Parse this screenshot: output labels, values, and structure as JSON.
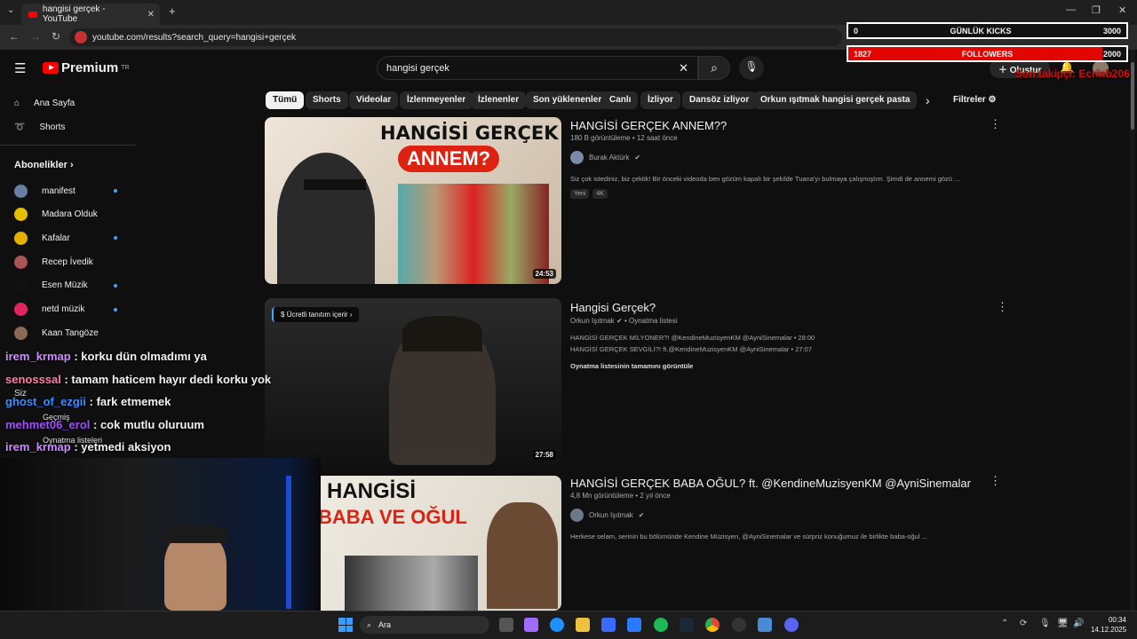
{
  "browser": {
    "tab_title": "hangisi gerçek - YouTube",
    "url": "youtube.com/results?search_query=hangisi+gerçek"
  },
  "header": {
    "logo_text": "Premium",
    "logo_region": "TR",
    "search_value": "hangisi gerçek",
    "create_label": "Oluştur"
  },
  "sidebar": {
    "items": [
      {
        "label": "Ana Sayfa"
      },
      {
        "label": "Shorts"
      }
    ],
    "subscriptions_title": "Abonelikler",
    "channels": [
      {
        "name": "manifest",
        "color": "#6a7fa8",
        "dot": true
      },
      {
        "name": "Madara Olduk",
        "color": "#e5c000",
        "dot": false
      },
      {
        "name": "Kafalar",
        "color": "#e5b000",
        "dot": true
      },
      {
        "name": "Recep İvedik",
        "color": "#a55",
        "dot": false
      },
      {
        "name": "Esen Müzik",
        "color": "#111",
        "dot": true
      },
      {
        "name": "netd müzik",
        "color": "#e0245e",
        "dot": true
      },
      {
        "name": "Kaan Tangöze",
        "color": "#8a6a55",
        "dot": false
      }
    ],
    "you_label": "Siz",
    "history_label": "Geçmiş",
    "playlists_label": "Oynatma listeleri"
  },
  "chips": [
    "Tümü",
    "Shorts",
    "Videolar",
    "İzlenmeyenler",
    "İzlenenler",
    "Son yüklenenler",
    "Canlı",
    "İzliyor",
    "Dansöz izliyor",
    "Orkun ışıtmak hangisi gerçek pasta"
  ],
  "filters_label": "Filtreler",
  "results": [
    {
      "title": "HANGİSİ GERÇEK ANNEM??",
      "meta": "180 B görüntüleme • 12 saat önce",
      "channel": "Burak Aktürk",
      "desc": "Siz çok istediniz, biz çektik! Bir önceki videoda ben gözüm kapalı bir şekilde Tuana'yı bulmaya çalışmıştım. Şimdi de annemi gözü ...",
      "badges": [
        "Yeni",
        "4K"
      ],
      "duration": "24:53",
      "thumb_text1": "HANGİSİ GERÇEK",
      "thumb_text2": "ANNEM?"
    },
    {
      "title": "Hangisi Gerçek?",
      "channel": "Orkun Işıtmak",
      "meta_suffix": "Oynatma listesi",
      "line1": "HANGİSİ GERÇEK MİLYONER?! @KendineMuzisyenKM @AyniSinemalar • 28:00",
      "line2": "HANGİSİ GERÇEK SEVGİLİ?! ft.@KendineMuzisyenKM @AyniSinemalar • 27:07",
      "link": "Oynatma listesinin tamamını görüntüle",
      "paid": "Ücretli tanıtım içerir",
      "duration": "27:58"
    },
    {
      "title": "HANGİSİ GERÇEK BABA OĞUL? ft. @KendineMuzisyenKM @AyniSinemalar",
      "meta": "4,8 Mn görüntüleme • 2 yıl önce",
      "channel": "Orkun Işıtmak",
      "desc": "Herkese selam, serinin bu bölümünde Kendine Müzisyen, @AyniSinemalar ve sürpriz konuğumuz ile birlikte baba-oğul ...",
      "thumb_text1": "HANGİSİ",
      "thumb_text2": "BABA VE OĞUL"
    }
  ],
  "stream_overlay": {
    "kicks_left": "0",
    "kicks_label": "GÜNLÜK KICKS",
    "kicks_right": "3000",
    "kicks_progress": 0,
    "followers_left": "1827",
    "followers_label": "FOLLOWERS",
    "followers_right": "2000",
    "followers_progress": 0.9135,
    "last_follower": "Son takipçi: Ecrinb206"
  },
  "chat": [
    {
      "user": "irem_krmap",
      "msg": " : korku dün olmadımı ya",
      "color": "#d08aff"
    },
    {
      "user": "senosssal",
      "msg": " : tamam haticem hayır dedi korku yok",
      "color": "#ff7ea9"
    },
    {
      "user": "ghost_of_ezgii",
      "msg": " : fark etmemek",
      "color": "#3a8dff"
    },
    {
      "user": "mehmet06_erol",
      "msg": " : cok mutlu oluruum",
      "color": "#a24dff"
    },
    {
      "user": "irem_krmap",
      "msg": " : yetmedi aksiyon",
      "color": "#d08aff"
    }
  ],
  "taskbar": {
    "search_placeholder": "Ara",
    "time": "00:34",
    "date": "14.12.2025"
  }
}
